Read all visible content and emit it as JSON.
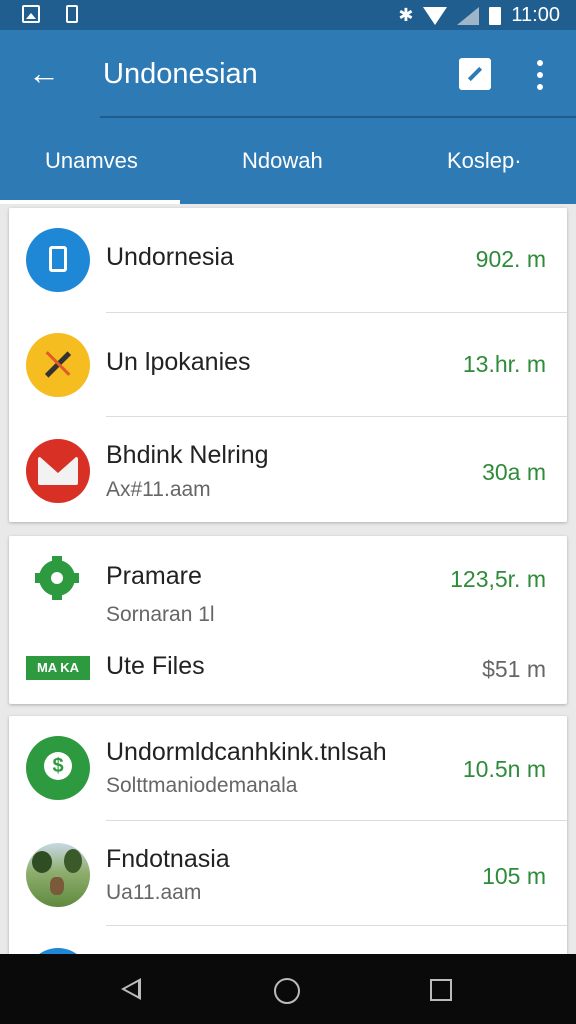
{
  "status_bar": {
    "time": "11:00"
  },
  "app_bar": {
    "title": "Undonesian"
  },
  "tabs": [
    {
      "label": "Unamves",
      "selected": true
    },
    {
      "label": "Ndowah",
      "selected": false
    },
    {
      "label": "Koslep·",
      "selected": false
    }
  ],
  "cards": [
    {
      "items": [
        {
          "name": "Undornesia",
          "subtitle": "",
          "size": "902. m",
          "icon": "blue-bag-icon",
          "color": "#1e88d6"
        },
        {
          "name": "Un lpokanies",
          "subtitle": "",
          "size": "13.hr. m",
          "icon": "yellow-pencil-icon",
          "color": "#f5bd1f"
        },
        {
          "name": "Bhdink Nelring",
          "subtitle": "Ax#11.aam",
          "size": "30a m",
          "icon": "gmail-envelope-icon",
          "color": "#d93025"
        }
      ]
    },
    {
      "items": [
        {
          "name": "Pramare",
          "subtitle": "Sornaran 1l",
          "size": "123,5r. m",
          "icon": "settings-gear-icon",
          "color": "#2e9a3f"
        },
        {
          "name": "Ute Files",
          "subtitle": "",
          "size": "$51 m",
          "icon": "green-label-icon",
          "color": "#2e9a3f",
          "icon_text": "MA KA"
        }
      ]
    },
    {
      "items": [
        {
          "name": "Undormldcanhkink.tnlsah",
          "subtitle": "Solttmaniodemanala",
          "size": "10.5n m",
          "icon": "green-dollar-icon",
          "color": "#2e9a3f"
        },
        {
          "name": "Fndotnasia",
          "subtitle": "Ua11.aam",
          "size": "105 m",
          "icon": "photo-thumbnail-icon",
          "color": "#6a8f4e"
        }
      ]
    }
  ]
}
